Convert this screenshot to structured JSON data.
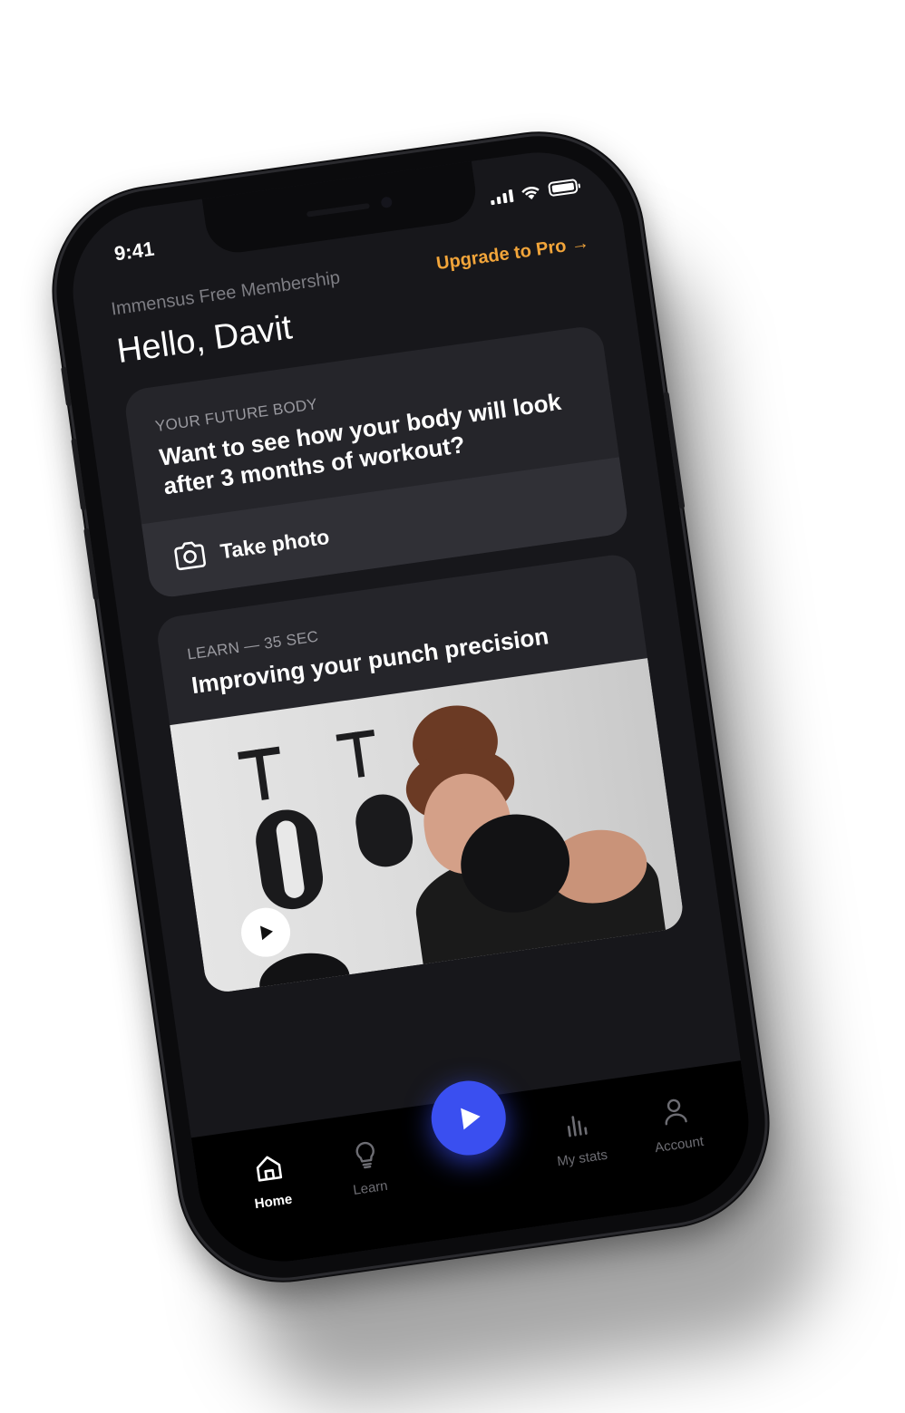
{
  "status": {
    "time": "9:41"
  },
  "header": {
    "membership": "Immensus Free Membership",
    "upgrade_label": "Upgrade to Pro →",
    "greeting": "Hello, Davit"
  },
  "future_body": {
    "eyebrow": "YOUR FUTURE BODY",
    "title": "Want to see how your body will look after 3 months of workout?",
    "action_label": "Take photo",
    "action_icon": "camera-icon"
  },
  "learn_card": {
    "eyebrow": "LEARN — 35 SEC",
    "title": "Improving your punch precision",
    "play_icon": "play-icon"
  },
  "tabbar": {
    "items": [
      {
        "label": "Home",
        "icon": "home-icon",
        "active": true
      },
      {
        "label": "Learn",
        "icon": "lightbulb-icon",
        "active": false
      },
      {
        "label": "My stats",
        "icon": "stats-icon",
        "active": false
      },
      {
        "label": "Account",
        "icon": "user-icon",
        "active": false
      }
    ],
    "center_icon": "play-icon"
  },
  "colors": {
    "accent_orange": "#f2a53a",
    "accent_blue": "#3a4ff0",
    "background": "#17171b",
    "card": "#25252a"
  }
}
